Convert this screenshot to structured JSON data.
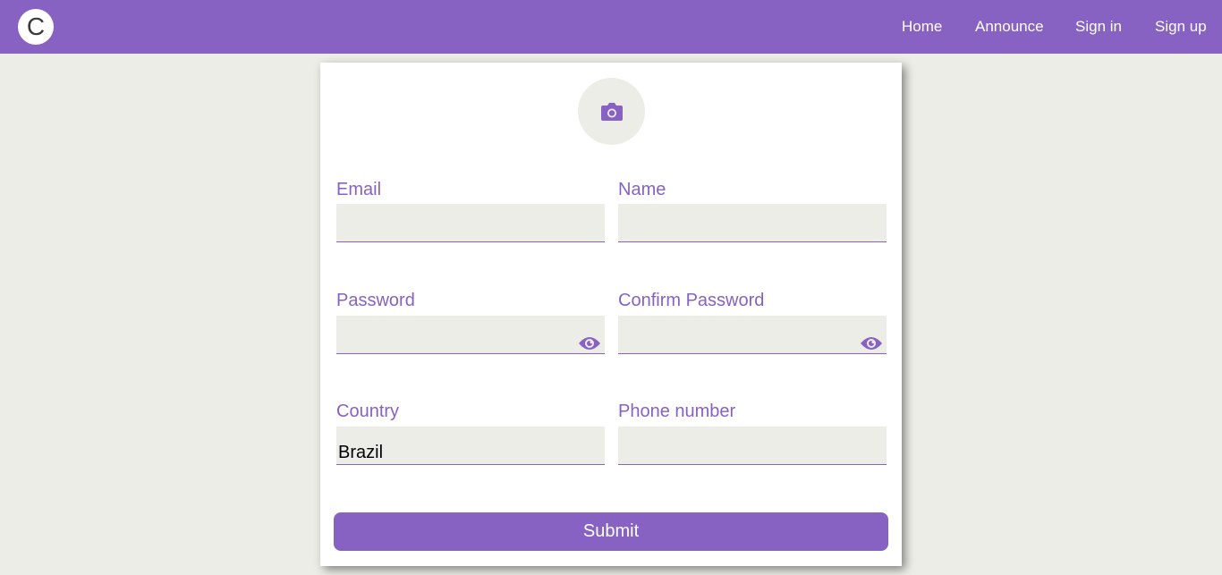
{
  "colors": {
    "accent": "#8762c2",
    "background": "#edede8",
    "card": "#ffffff"
  },
  "nav": {
    "logo_letter": "C",
    "links": [
      {
        "label": "Home"
      },
      {
        "label": "Announce"
      },
      {
        "label": "Sign in"
      },
      {
        "label": "Sign up"
      }
    ]
  },
  "form": {
    "avatar_icon": "camera-icon",
    "fields": {
      "email": {
        "label": "Email",
        "value": ""
      },
      "name": {
        "label": "Name",
        "value": ""
      },
      "password": {
        "label": "Password",
        "value": "",
        "icon": "eye-icon"
      },
      "confirm_password": {
        "label": "Confirm Password",
        "value": "",
        "icon": "eye-icon"
      },
      "country": {
        "label": "Country",
        "value": "Brazil"
      },
      "phone": {
        "label": "Phone number",
        "value": ""
      }
    },
    "submit_label": "Submit"
  }
}
